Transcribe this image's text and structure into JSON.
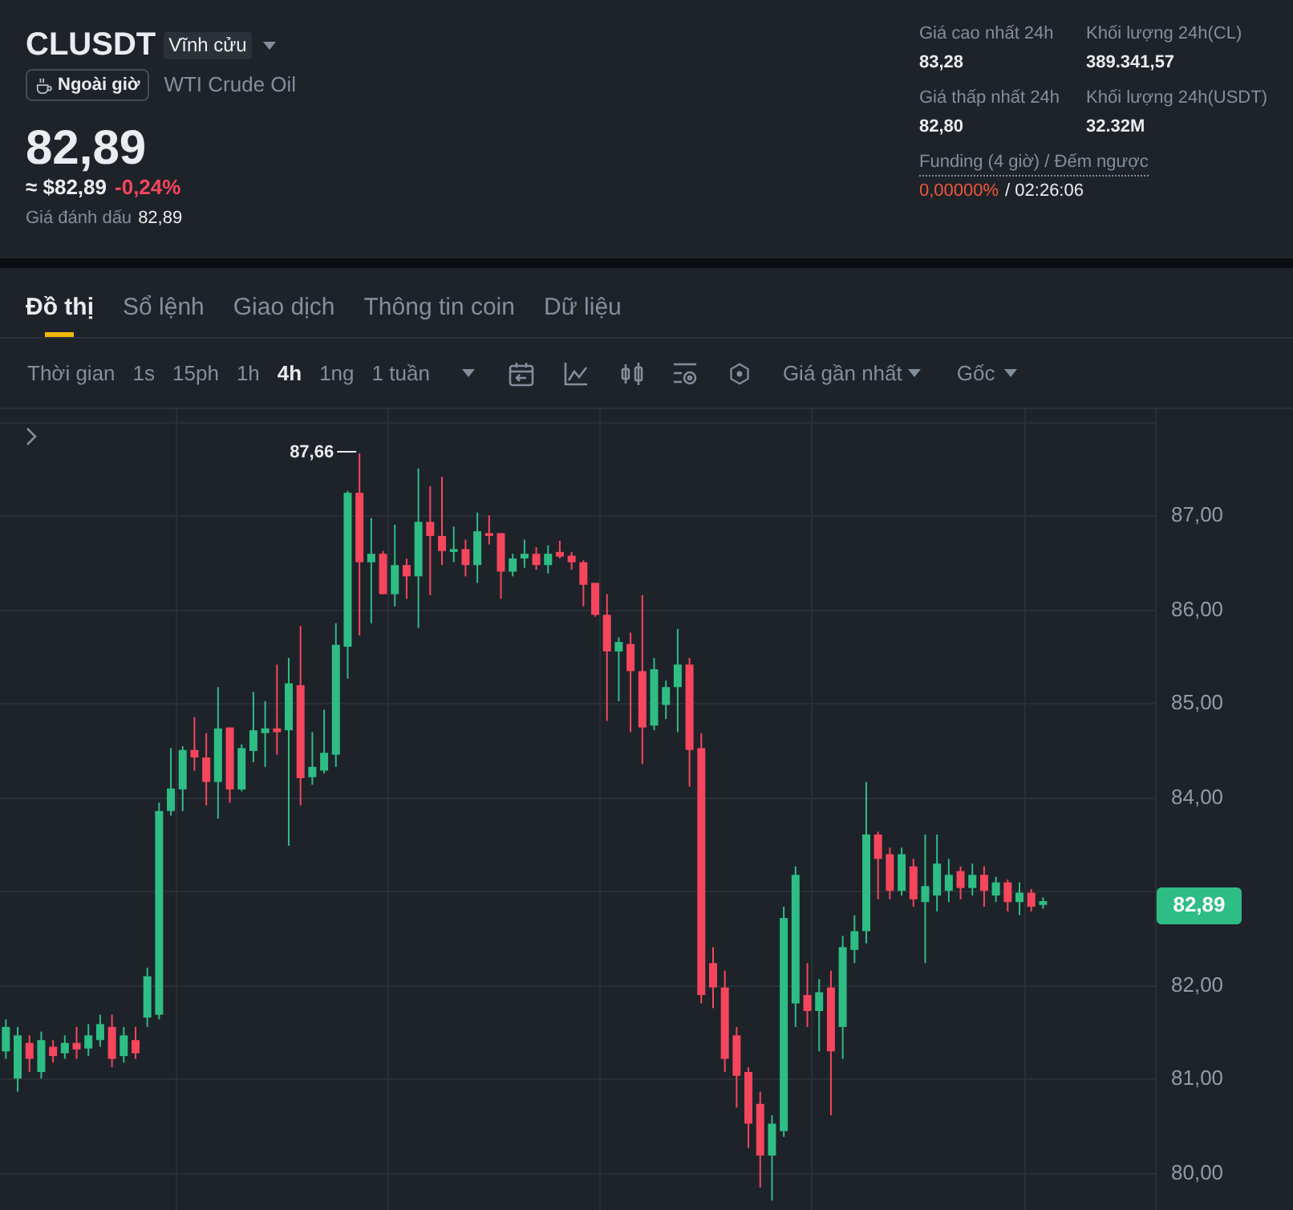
{
  "header": {
    "symbol": "CLUSDT",
    "contract_type": "Vĩnh cửu",
    "session": "Ngoài giờ",
    "name": "WTI Crude Oil",
    "last_price": "82,89",
    "usd_price": "≈ $82,89",
    "change": "-0,24%",
    "falling": true,
    "mark_price_label": "Giá đánh dấu",
    "mark_price": "82,89"
  },
  "stats": [
    {
      "label": "Giá cao nhất 24h",
      "value": "83,28"
    },
    {
      "label": "Khối lượng 24h(CL)",
      "value": "389.341,57"
    },
    {
      "label": "Giá thấp nhất 24h",
      "value": "82,80"
    },
    {
      "label": "Khối lượng 24h(USDT)",
      "value": "32.32M"
    }
  ],
  "funding": {
    "label": "Funding (4 giờ) / Đếm ngược",
    "rate": "0,00000%",
    "countdown": "/ 02:26:06"
  },
  "tabs": [
    {
      "label": "Đồ thị",
      "selected": true
    },
    {
      "label": "Sổ lệnh",
      "selected": false
    },
    {
      "label": "Giao dịch",
      "selected": false
    },
    {
      "label": "Thông tin coin",
      "selected": false
    },
    {
      "label": "Dữ liệu",
      "selected": false
    }
  ],
  "toolbar": {
    "label": "Thời gian",
    "intervals": [
      {
        "label": "1s",
        "selected": false
      },
      {
        "label": "15ph",
        "selected": false
      },
      {
        "label": "1h",
        "selected": false
      },
      {
        "label": "4h",
        "selected": true
      },
      {
        "label": "1ng",
        "selected": false
      },
      {
        "label": "1 tuần",
        "selected": false
      }
    ],
    "price_source": "Giá gần nhất",
    "scale": "Gốc"
  },
  "chart": {
    "high_label": "87,66",
    "last_price": "82,89",
    "chart_data": {
      "type": "candlestick",
      "grid": true,
      "categories": [
        null,
        null,
        null,
        null,
        null,
        null,
        null,
        null,
        null,
        null,
        null,
        null,
        null,
        null,
        null,
        null,
        null,
        null,
        null,
        null,
        null,
        null,
        null,
        null,
        null,
        null,
        null,
        null,
        null,
        null,
        null,
        null,
        null,
        null,
        null,
        null,
        null,
        null,
        null,
        null,
        null,
        null,
        null,
        null,
        null,
        null,
        null,
        null,
        null,
        null,
        null,
        null,
        null,
        null,
        null,
        null,
        null,
        null,
        null,
        null,
        null,
        null,
        null,
        null,
        null,
        null,
        null,
        null,
        null,
        null,
        null,
        null,
        null,
        null,
        null,
        null,
        null,
        null,
        null,
        null,
        null,
        null,
        null,
        null,
        null,
        null,
        null,
        null,
        null,
        null,
        null,
        null,
        null,
        null,
        null,
        null,
        null,
        null
      ],
      "ylim": [
        79.6,
        88.13
      ],
      "yticks": [
        {
          "value": 87,
          "label": "87,00"
        },
        {
          "value": 86,
          "label": "86,00"
        },
        {
          "value": 85,
          "label": "85,00"
        },
        {
          "value": 84,
          "label": "84,00"
        },
        {
          "value": 82,
          "label": "82,00"
        },
        {
          "value": 81,
          "label": "81,00"
        },
        {
          "value": 80,
          "label": "80,00"
        }
      ],
      "ohlc": [
        [
          81.29,
          81.63,
          81.21,
          81.55
        ],
        [
          81.0,
          81.55,
          80.86,
          81.46
        ],
        [
          81.38,
          81.46,
          81.07,
          81.21
        ],
        [
          81.07,
          81.5,
          81.0,
          81.41
        ],
        [
          81.34,
          81.41,
          81.17,
          81.24
        ],
        [
          81.27,
          81.46,
          81.21,
          81.38
        ],
        [
          81.38,
          81.55,
          81.21,
          81.31
        ],
        [
          81.32,
          81.58,
          81.24,
          81.46
        ],
        [
          81.41,
          81.68,
          81.34,
          81.58
        ],
        [
          81.55,
          81.68,
          81.12,
          81.21
        ],
        [
          81.24,
          81.55,
          81.17,
          81.46
        ],
        [
          81.41,
          81.55,
          81.21,
          81.27
        ],
        [
          81.65,
          82.18,
          81.55,
          82.09
        ],
        [
          81.68,
          83.94,
          81.63,
          83.85
        ],
        [
          83.85,
          84.52,
          83.8,
          84.09
        ],
        [
          84.08,
          84.54,
          83.85,
          84.5
        ],
        [
          84.5,
          84.85,
          84.28,
          84.42
        ],
        [
          84.42,
          84.68,
          83.91,
          84.16
        ],
        [
          84.16,
          85.17,
          83.77,
          84.73
        ],
        [
          84.74,
          84.74,
          83.94,
          84.08
        ],
        [
          84.08,
          84.56,
          84.06,
          84.52
        ],
        [
          84.49,
          85.12,
          84.37,
          84.71
        ],
        [
          84.68,
          85.02,
          84.32,
          84.73
        ],
        [
          84.73,
          85.41,
          84.45,
          84.69
        ],
        [
          84.71,
          85.48,
          83.48,
          85.21
        ],
        [
          85.19,
          85.82,
          83.91,
          84.2
        ],
        [
          84.21,
          84.69,
          84.13,
          84.32
        ],
        [
          84.28,
          84.93,
          84.25,
          84.47
        ],
        [
          84.45,
          85.85,
          84.32,
          85.62
        ],
        [
          85.6,
          87.26,
          85.26,
          87.24
        ],
        [
          87.24,
          87.66,
          85.72,
          86.5
        ],
        [
          86.5,
          86.97,
          85.85,
          86.59
        ],
        [
          86.59,
          86.62,
          86.16,
          86.16
        ],
        [
          86.16,
          86.9,
          86.03,
          86.47
        ],
        [
          86.47,
          86.54,
          86.11,
          86.35
        ],
        [
          86.35,
          87.5,
          85.8,
          86.93
        ],
        [
          86.93,
          87.31,
          86.15,
          86.78
        ],
        [
          86.78,
          87.41,
          86.47,
          86.62
        ],
        [
          86.61,
          86.88,
          86.5,
          86.64
        ],
        [
          86.64,
          86.74,
          86.35,
          86.47
        ],
        [
          86.47,
          87.03,
          86.28,
          86.83
        ],
        [
          86.81,
          87.0,
          86.69,
          86.78
        ],
        [
          86.81,
          86.81,
          86.11,
          86.4
        ],
        [
          86.4,
          86.59,
          86.35,
          86.54
        ],
        [
          86.54,
          86.74,
          86.44,
          86.59
        ],
        [
          86.59,
          86.66,
          86.42,
          86.47
        ],
        [
          86.47,
          86.68,
          86.38,
          86.59
        ],
        [
          86.61,
          86.73,
          86.54,
          86.56
        ],
        [
          86.57,
          86.61,
          86.42,
          86.5
        ],
        [
          86.5,
          86.52,
          86.03,
          86.26
        ],
        [
          86.28,
          86.28,
          85.92,
          85.94
        ],
        [
          85.94,
          86.16,
          84.81,
          85.55
        ],
        [
          85.55,
          85.7,
          85.02,
          85.65
        ],
        [
          85.63,
          85.75,
          84.69,
          85.34
        ],
        [
          85.34,
          86.15,
          84.35,
          84.74
        ],
        [
          84.76,
          85.48,
          84.71,
          85.36
        ],
        [
          84.98,
          85.24,
          84.83,
          85.17
        ],
        [
          85.17,
          85.79,
          84.69,
          85.41
        ],
        [
          85.41,
          85.48,
          84.11,
          84.5
        ],
        [
          84.52,
          84.68,
          81.8,
          81.89
        ],
        [
          82.23,
          82.4,
          81.75,
          81.97
        ],
        [
          81.97,
          82.15,
          81.07,
          81.21
        ],
        [
          81.46,
          81.55,
          80.69,
          81.03
        ],
        [
          81.07,
          81.12,
          80.26,
          80.52
        ],
        [
          80.73,
          80.86,
          79.84,
          80.18
        ],
        [
          80.18,
          80.61,
          79.7,
          80.52
        ],
        [
          80.44,
          82.83,
          80.38,
          82.71
        ],
        [
          81.8,
          83.26,
          81.55,
          83.17
        ],
        [
          81.89,
          82.23,
          81.55,
          81.72
        ],
        [
          81.72,
          82.06,
          81.29,
          81.92
        ],
        [
          81.97,
          82.15,
          80.61,
          81.29
        ],
        [
          81.55,
          82.52,
          81.21,
          82.4
        ],
        [
          82.37,
          82.74,
          82.23,
          82.57
        ],
        [
          82.57,
          84.16,
          82.44,
          83.6
        ],
        [
          83.6,
          83.63,
          82.91,
          83.34
        ],
        [
          83.39,
          83.46,
          82.91,
          83.0
        ],
        [
          83.0,
          83.46,
          82.95,
          83.39
        ],
        [
          83.26,
          83.34,
          82.83,
          82.91
        ],
        [
          82.88,
          83.6,
          82.23,
          83.05
        ],
        [
          82.95,
          83.6,
          82.78,
          83.29
        ],
        [
          83.0,
          83.34,
          82.88,
          83.17
        ],
        [
          83.21,
          83.26,
          82.91,
          83.03
        ],
        [
          83.03,
          83.29,
          82.95,
          83.17
        ],
        [
          83.17,
          83.26,
          82.83,
          83.0
        ],
        [
          82.95,
          83.15,
          82.88,
          83.09
        ],
        [
          83.09,
          83.12,
          82.78,
          82.88
        ],
        [
          82.88,
          83.09,
          82.74,
          82.98
        ],
        [
          82.98,
          83.02,
          82.78,
          82.83
        ],
        [
          82.85,
          82.93,
          82.81,
          82.89
        ],
        null,
        null,
        null,
        null,
        null,
        null,
        null,
        null,
        null
      ]
    }
  }
}
